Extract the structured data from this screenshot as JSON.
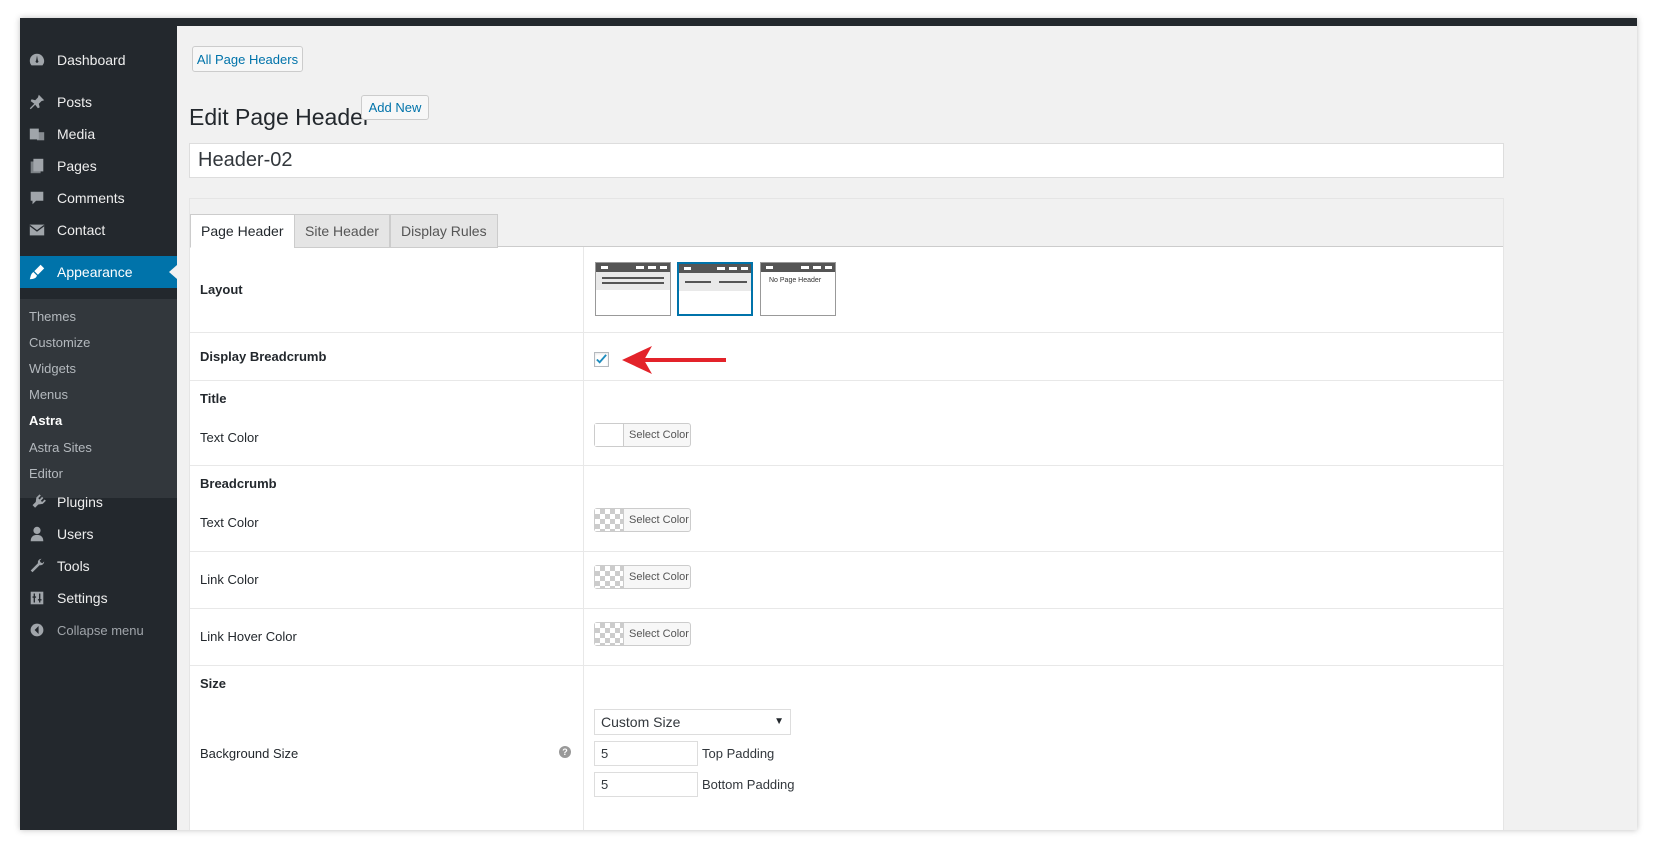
{
  "sidebar": {
    "items": [
      {
        "label": "Dashboard",
        "icon": "dashboard-icon"
      },
      {
        "label": "Posts",
        "icon": "pin-icon"
      },
      {
        "label": "Media",
        "icon": "media-icon"
      },
      {
        "label": "Pages",
        "icon": "pages-icon"
      },
      {
        "label": "Comments",
        "icon": "comment-icon"
      },
      {
        "label": "Contact",
        "icon": "mail-icon"
      },
      {
        "label": "Appearance",
        "icon": "brush-icon"
      },
      {
        "label": "Plugins",
        "icon": "plugin-icon"
      },
      {
        "label": "Users",
        "icon": "user-icon"
      },
      {
        "label": "Tools",
        "icon": "wrench-icon"
      },
      {
        "label": "Settings",
        "icon": "settings-icon"
      }
    ],
    "submenu": [
      "Themes",
      "Customize",
      "Widgets",
      "Menus",
      "Astra",
      "Astra Sites",
      "Editor"
    ],
    "collapse_label": "Collapse menu"
  },
  "header": {
    "back_button": "All Page Headers",
    "title": "Edit Page Header",
    "add_new": "Add New",
    "post_title_value": "Header-02"
  },
  "tabs": [
    "Page Header",
    "Site Header",
    "Display Rules"
  ],
  "fields": {
    "layout_label": "Layout",
    "layout_no_header_text": "No Page Header",
    "breadcrumb_toggle_label": "Display Breadcrumb",
    "breadcrumb_toggle_checked": true,
    "title_section": "Title",
    "title_text_color": "Text Color",
    "breadcrumb_section": "Breadcrumb",
    "breadcrumb_text_color": "Text Color",
    "breadcrumb_link_color": "Link Color",
    "breadcrumb_link_hover_color": "Link Hover Color",
    "select_color": "Select Color",
    "size_section": "Size",
    "background_size_label": "Background Size",
    "background_size_value": "Custom Size",
    "top_padding_value": "5",
    "top_padding_label": "Top Padding",
    "bottom_padding_value": "5",
    "bottom_padding_label": "Bottom Padding"
  },
  "colors": {
    "sidebar_bg": "#23282d",
    "active_menu": "#0073aa",
    "arrow_annotation": "#e3232a"
  }
}
